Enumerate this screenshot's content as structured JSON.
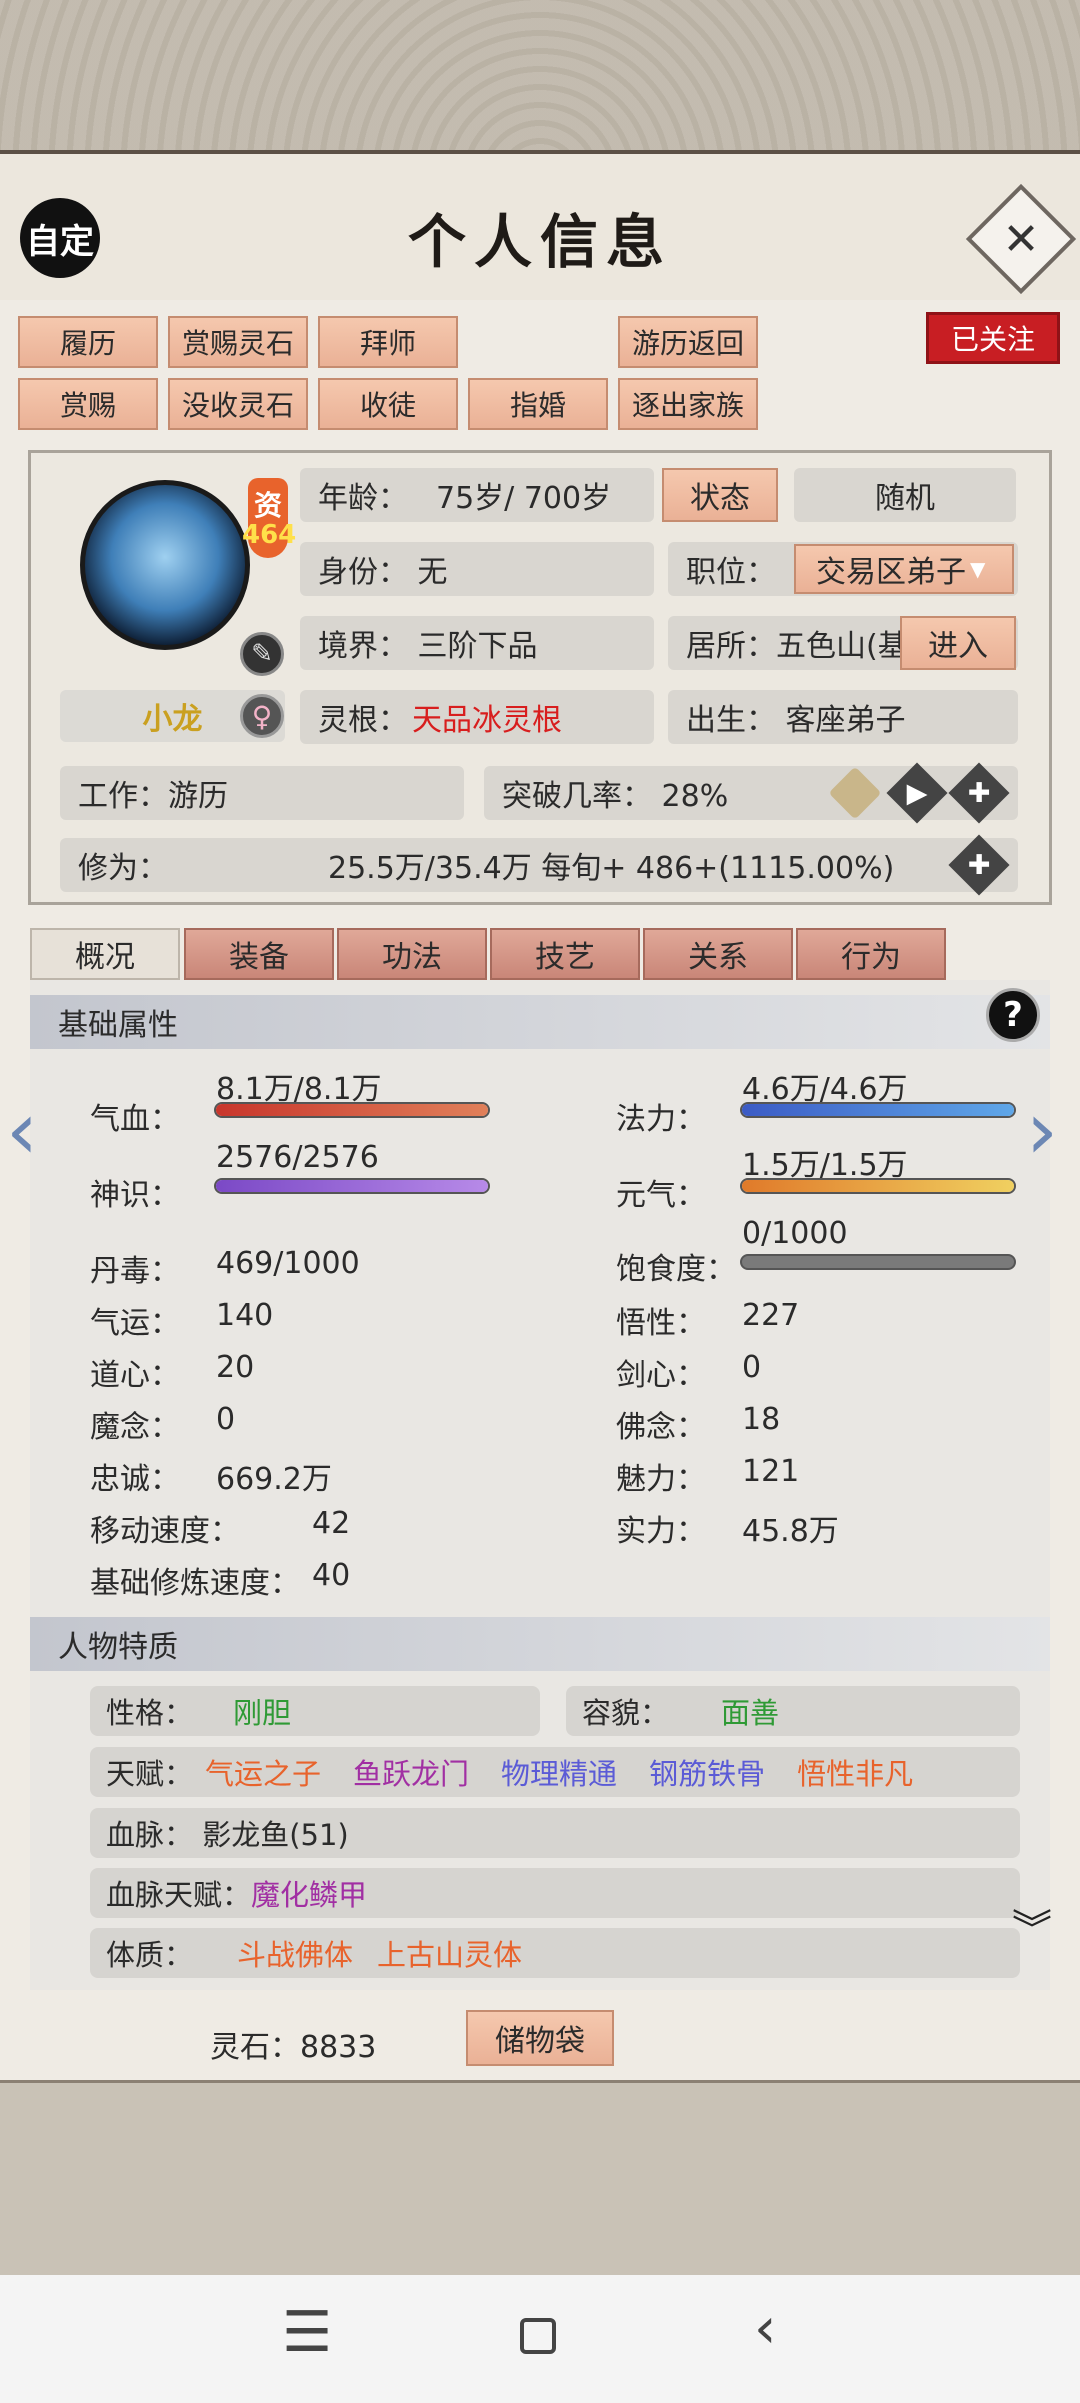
{
  "header": {
    "title": "个人信息",
    "auto_label": "自定"
  },
  "actions_row1": [
    "履历",
    "赏赐灵石",
    "拜师",
    "游历返回"
  ],
  "actions_row2": [
    "赏赐",
    "没收灵石",
    "收徒",
    "指婚",
    "逐出家族"
  ],
  "follow_label": "已关注",
  "profile": {
    "zi_label": "资",
    "zi_value": "464",
    "name": "小龙",
    "age_label": "年龄：",
    "age_value": "75岁/ 700岁",
    "status_button": "状态",
    "random_button": "随机",
    "identity": "身份：  无",
    "position_label": "职位：",
    "position_value": "交易区弟子",
    "realm": "境界：  三阶下品",
    "residence": "居所：五色山(基",
    "enter_button": "进入",
    "root_label": "灵根：",
    "root_value": "天品冰灵根",
    "birth": "出生：  客座弟子",
    "work": "工作：游历",
    "breakthrough": "突破几率：  28%",
    "cultivation_label": "修为：",
    "cultivation_value": "25.5万/35.4万  每旬+   486+(1115.00%)"
  },
  "tabs": [
    "概况",
    "装备",
    "功法",
    "技艺",
    "关系",
    "行为"
  ],
  "basic_section": "基础属性",
  "help_icon": "?",
  "bars": [
    {
      "label": "气血：",
      "value": "8.1万/8.1万",
      "fill": 1.0,
      "color_from": "#c8362c",
      "color_to": "#e0805a"
    },
    {
      "label": "法力：",
      "value": "4.6万/4.6万",
      "fill": 1.0,
      "color_from": "#3b5bc5",
      "color_to": "#5fa7e8"
    },
    {
      "label": "神识：",
      "value": "2576/2576",
      "fill": 1.0,
      "color_from": "#7b49c6",
      "color_to": "#b78ae8"
    },
    {
      "label": "元气：",
      "value": "1.5万/1.5万",
      "fill": 1.0,
      "color_from": "#e07a2a",
      "color_to": "#f0d060"
    },
    {
      "label": "饱食度：",
      "value": "0/1000",
      "fill": 0.0,
      "color_from": "#7a7a7a",
      "color_to": "#7a7a7a"
    }
  ],
  "stats_left": [
    {
      "label": "丹毒：",
      "value": "469/1000"
    },
    {
      "label": "气运：",
      "value": "140"
    },
    {
      "label": "道心：",
      "value": "20"
    },
    {
      "label": "魔念：",
      "value": "0"
    },
    {
      "label": "忠诚：",
      "value": "669.2万"
    },
    {
      "label": "移动速度：",
      "value": "42"
    },
    {
      "label": "基础修炼速度：",
      "value": "40"
    }
  ],
  "stats_right": [
    {
      "label": "悟性：",
      "value": "227"
    },
    {
      "label": "剑心：",
      "value": "0"
    },
    {
      "label": "佛念：",
      "value": "18"
    },
    {
      "label": "魅力：",
      "value": "121"
    },
    {
      "label": "实力：",
      "value": "45.8万"
    }
  ],
  "traits_section": "人物特质",
  "traits": {
    "personality_label": "性格：",
    "personality_value": "刚胆",
    "appearance_label": "容貌：",
    "appearance_value": "面善",
    "talent_label": "天赋：",
    "talents": [
      {
        "text": "气运之子",
        "color": "#e8632c"
      },
      {
        "text": "鱼跃龙门",
        "color": "#a12fa3"
      },
      {
        "text": "物理精通",
        "color": "#5b5bd6"
      },
      {
        "text": "钢筋铁骨",
        "color": "#5b5bd6"
      },
      {
        "text": "悟性非凡",
        "color": "#e8632c"
      }
    ],
    "bloodline": "血脉：  影龙鱼(51)",
    "bloodline_talent_label": "血脉天赋：",
    "bloodline_talent_value": "魔化鳞甲",
    "physique_label": "体质：",
    "physique_values": [
      "斗战佛体",
      "上古山灵体"
    ]
  },
  "footer": {
    "spirit_stones": "灵石：8833",
    "bag_button": "储物袋"
  },
  "colors": {
    "root": "#d81e1e",
    "personality": "#2f9a35",
    "bloodline_talent": "#a12fa3",
    "physique": "#e8632c"
  }
}
